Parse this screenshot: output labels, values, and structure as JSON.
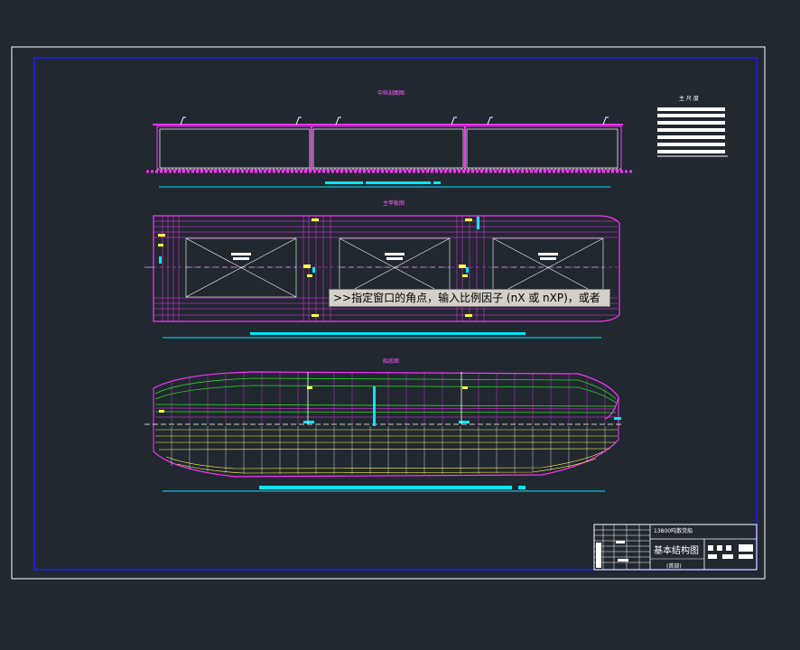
{
  "views": {
    "midship_section": "中纵剖面图",
    "main_deck": "主甲板图",
    "bottom_plan": "船底图"
  },
  "dimensions_table": {
    "title": "主 尺 度"
  },
  "title_block": {
    "ship_name": "13800吨散货船",
    "drawing_title": "基本结构图",
    "sub_title": "(首部)"
  },
  "command_tooltip": ">>指定窗口的角点，输入比例因子 (nX 或 nXP)，或者",
  "colors": {
    "background": "#212830",
    "frame": "#ffffff",
    "border": "#1d1dff",
    "structure": "#ff33ff",
    "green": "#26d626",
    "yellow": "#ffff44",
    "cyan": "#00e8ff"
  }
}
